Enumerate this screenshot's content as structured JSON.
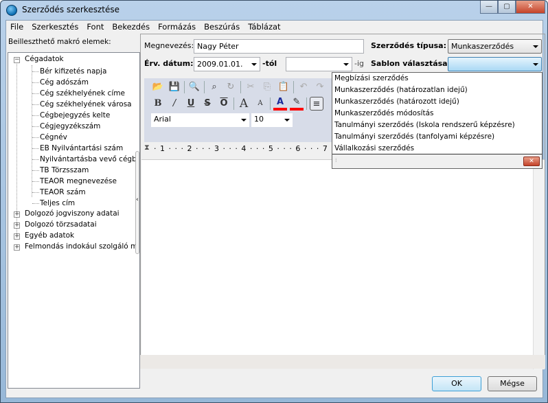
{
  "window": {
    "title": "Szerződés szerkesztése",
    "minimize": "—",
    "maximize": "▢",
    "close": "✕"
  },
  "menu": [
    "File",
    "Szerkesztés",
    "Font",
    "Bekezdés",
    "Formázás",
    "Beszúrás",
    "Táblázat"
  ],
  "left": {
    "label": "Beilleszthető makró elemek:",
    "tree": {
      "root": "Cégadatok",
      "children": [
        "Bér kifizetés napja",
        "Cég adószám",
        "Cég székhelyének címe",
        "Cég székhelyének városa",
        "Cégbejegyzés kelte",
        "Cégjegyzékszám",
        "Cégnév",
        "EB Nyilvántartási szám",
        "Nyilvántartásba vevő cégbíróság",
        "TB Törzsszam",
        "TEAOR megnevezése",
        "TEAOR szám",
        "Teljes cím"
      ],
      "collapsed": [
        "Dolgozó jogviszony adatai",
        "Dolgozó törzsadatai",
        "Egyéb adatok",
        "Felmondás indokául szolgáló magatartás"
      ]
    }
  },
  "form": {
    "name_label": "Megnevezés:",
    "name_value": "Nagy Péter",
    "date_label": "Érv. dátum:",
    "date_from": "2009.01.01.",
    "from_suffix": "-tól",
    "date_to": "",
    "to_suffix": "-ig",
    "type_label": "Szerződés típusa:",
    "type_value": "Munkaszerződés",
    "template_label": "Sablon választása:",
    "template_value": ""
  },
  "toolbar": {
    "font": "Arial",
    "size": "10",
    "ruler": "· 1 · · · 2 · · · 3 · · · 4 · · · 5 · · · 6 · · · 7",
    "text_color": "#ff0000",
    "highlight_color": "#ff0000"
  },
  "dropdown": {
    "items": [
      "Megbízási szerződés",
      "Munkaszerződés (határozatlan idejű)",
      "Munkaszerződés (határozott idejű)",
      "Munkaszerződés módosítás",
      "Tanulmányi szerződés (Iskola rendszerű képzésre)",
      "Tanulmányi szerződés (tanfolyami képzésre)",
      "Vállalkozási szerződés"
    ],
    "close": "✕"
  },
  "buttons": {
    "ok": "OK",
    "cancel": "Mégse"
  }
}
